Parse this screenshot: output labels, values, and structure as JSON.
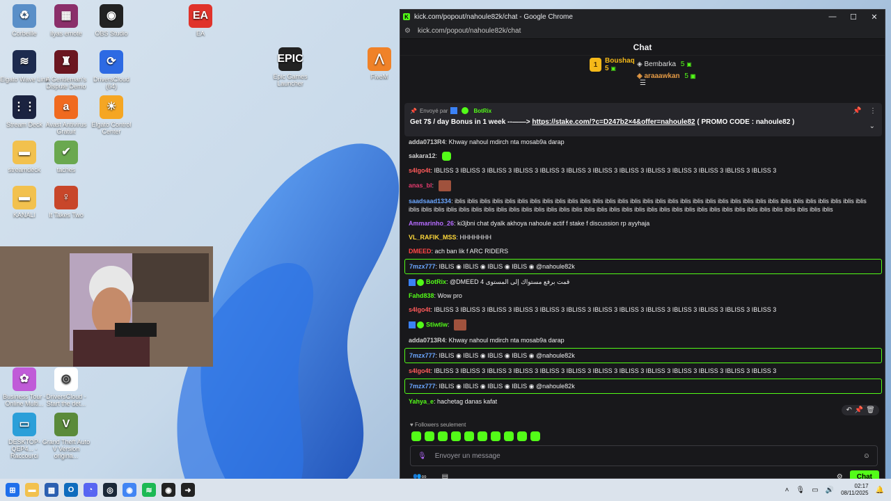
{
  "desktop": {
    "icons": [
      {
        "label": "Corbeille",
        "glyph": "♻",
        "color": "#5a8fc8"
      },
      {
        "label": "ilyas emote",
        "glyph": "▦",
        "color": "#8b2f6a"
      },
      {
        "label": "OBS Studio",
        "glyph": "◉",
        "color": "#222222"
      },
      {
        "label": "EA",
        "glyph": "EA",
        "color": "#e0332b"
      },
      {
        "label": "Elgato Wave Link",
        "glyph": "≋",
        "color": "#1d2b4f"
      },
      {
        "label": "A Gentleman's Dispute Demo",
        "glyph": "♜",
        "color": "#6b1620"
      },
      {
        "label": "DriversCloud (64)",
        "glyph": "⟳",
        "color": "#2d6ae3"
      },
      {
        "label": "Epic Games Launcher",
        "glyph": "EPIC",
        "color": "#222222"
      },
      {
        "label": "FiveM",
        "glyph": "⋀",
        "color": "#f08228"
      },
      {
        "label": "Stream Deck",
        "glyph": "⋮⋮",
        "color": "#1b2340"
      },
      {
        "label": "Avast Antivirus Gratuit",
        "glyph": "a",
        "color": "#f06a1f"
      },
      {
        "label": "Elgato Control Center",
        "glyph": "☀",
        "color": "#f5a623"
      },
      {
        "label": "streamdeck",
        "glyph": "▬",
        "color": "#f2c14e"
      },
      {
        "label": "taches",
        "glyph": "✔",
        "color": "#6aa84f"
      },
      {
        "label": "KANALI",
        "glyph": "▬",
        "color": "#f2c14e"
      },
      {
        "label": "It Takes Two",
        "glyph": "♀",
        "color": "#c8462a"
      },
      {
        "label": "Business Tour - Online Multi...",
        "glyph": "✿",
        "color": "#c05bd8"
      },
      {
        "label": "DriversCloud - Start the det...",
        "glyph": "◎",
        "color": "#ffffff"
      },
      {
        "label": "DESKTOP-QEP4... - Raccourci",
        "glyph": "▭",
        "color": "#2b9fd9"
      },
      {
        "label": "Grand Theft Auto V Version origina...",
        "glyph": "V",
        "color": "#5a8a3a"
      }
    ]
  },
  "browser": {
    "title": "kick.com/popout/nahoule82k/chat - Google Chrome",
    "url": "kick.com/popout/nahoule82k/chat",
    "minimize": "—",
    "maximize": "☐",
    "close": "✕"
  },
  "chat": {
    "header": "Chat",
    "leaderboard": {
      "first": {
        "rank": "1",
        "name": "Boushaq",
        "count": "5"
      },
      "second": {
        "name": "Bembarka",
        "count": "5"
      },
      "third": {
        "name": "araaawkan",
        "count": "5"
      }
    },
    "pinned": {
      "sent_by": "Envoyé par",
      "sender": "BotRix",
      "message_prefix": "Get 7$ / day Bonus in 1 week --——>",
      "link": "https://stake.com/?c=D247b2×4&offer=nahoule82",
      "message_suffix": "( PROMO CODE : nahoule82 )"
    },
    "messages": [
      {
        "user": "adda0713R4",
        "color": "#cfcfcf",
        "text": "Khway nahoul mdirch nta mosab9a darap",
        "highlight": false,
        "emotes": 0
      },
      {
        "user": "sakara12",
        "color": "#cfcfcf",
        "text": "",
        "highlight": false,
        "emotes": 1,
        "emote_kind": "gr"
      },
      {
        "user": "s4lgo4t",
        "color": "#ff5a5a",
        "text": "IBLISS 3 IBLISS 3 IBLISS 3 IBLISS 3 IBLISS 3 IBLISS 3 IBLISS 3 IBLISS 3 IBLISS 3 IBLISS 3 IBLISS 3 IBLISS 3 IBLISS 3",
        "highlight": false,
        "emotes": 0
      },
      {
        "user": "anas_bl",
        "color": "#e23a6d",
        "text": "",
        "highlight": false,
        "emotes": 1,
        "emote_kind": "sq"
      },
      {
        "user": "saadsaad1334",
        "color": "#6aa6ff",
        "text": "iblis iblis iblis iblis iblis iblis iblis iblis iblis iblis iblis iblis iblis iblis iblis iblis iblis iblis iblis iblis iblis iblis iblis iblis iblis iblis iblis iblis iblis iblis iblis iblis iblis iblis iblis iblis iblis iblis iblis iblis iblis iblis iblis iblis iblis iblis iblis iblis iblis iblis iblis iblis iblis iblis iblis iblis iblis iblis iblis iblis iblis iblis iblis iblis iblis iblis iblis",
        "highlight": false,
        "emotes": 0
      },
      {
        "user": "Ammarinho_26",
        "color": "#b66cff",
        "text": "ki3jbni chat dyalk akhoya nahoule actif f stake f discussion rp ayyhaja",
        "highlight": false,
        "emotes": 0
      },
      {
        "user": "VL_RAFIK_MSS",
        "color": "#ffd93b",
        "text": "HHHHHHH",
        "highlight": false,
        "emotes": 0
      },
      {
        "user": "DMEED",
        "color": "#ff4747",
        "text": "ach ban lik f ARC RIDERS",
        "highlight": false,
        "emotes": 0
      },
      {
        "user": "7mzx777",
        "color": "#6aa6ff",
        "text": "IBLIS ◉ IBLIS ◉ IBLIS ◉ IBLIS ◉ @nahoule82k",
        "highlight": true,
        "emotes": 0
      },
      {
        "user": "BotRix",
        "color": "#53fc18",
        "text": "@DMEED قمت برفع مستواك إلى المستوى 4",
        "highlight": false,
        "emotes": 0,
        "bot": true
      },
      {
        "user": "Fahd838",
        "color": "#53fc18",
        "text": "Wow pro",
        "highlight": false,
        "emotes": 0
      },
      {
        "user": "s4lgo4t",
        "color": "#ff5a5a",
        "text": "IBLISS 3 IBLISS 3 IBLISS 3 IBLISS 3 IBLISS 3 IBLISS 3 IBLISS 3 IBLISS 3 IBLISS 3 IBLISS 3 IBLISS 3 IBLISS 3 IBLISS 3",
        "highlight": false,
        "emotes": 0
      },
      {
        "user": "Stiwtiw",
        "color": "#53fc18",
        "text": "",
        "highlight": false,
        "emotes": 1,
        "emote_kind": "sq",
        "bot": true
      },
      {
        "user": "adda0713R4",
        "color": "#cfcfcf",
        "text": "Khway nahoul mdirch nta mosab9a darap",
        "highlight": false,
        "emotes": 0
      },
      {
        "user": "7mzx777",
        "color": "#6aa6ff",
        "text": "IBLIS ◉ IBLIS ◉ IBLIS ◉ IBLIS ◉ @nahoule82k",
        "highlight": true,
        "emotes": 0
      },
      {
        "user": "s4lgo4t",
        "color": "#ff5a5a",
        "text": "IBLISS 3 IBLISS 3 IBLISS 3 IBLISS 3 IBLISS 3 IBLISS 3 IBLISS 3 IBLISS 3 IBLISS 3 IBLISS 3 IBLISS 3 IBLISS 3 IBLISS 3",
        "highlight": false,
        "emotes": 0
      },
      {
        "user": "7mzx777",
        "color": "#6aa6ff",
        "text": "IBLIS ◉ IBLIS ◉ IBLIS ◉ IBLIS ◉ @nahoule82k",
        "highlight": true,
        "emotes": 0
      },
      {
        "user": "Yahya_e",
        "color": "#53fc18",
        "text": "hachetag danas kafat",
        "highlight": false,
        "emotes": 0
      }
    ],
    "followers_only": "Followers seulement",
    "input_placeholder": "Envoyer un message",
    "send_label": "Chat"
  },
  "taskbar": {
    "time": "02:17",
    "date": "08/11/2025"
  }
}
